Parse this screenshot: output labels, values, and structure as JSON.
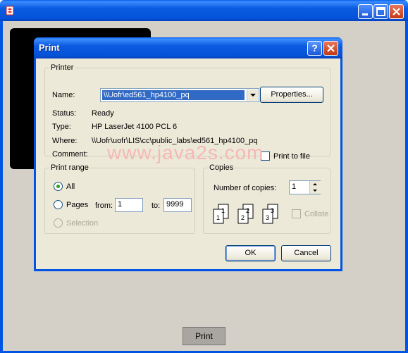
{
  "dialog": {
    "title": "Print",
    "help_label": "?"
  },
  "printer": {
    "group_label": "Printer",
    "name_label": "Name:",
    "name_value": "\\\\Uofr\\ed561_hp4100_pq",
    "properties_label": "Properties...",
    "status_label": "Status:",
    "status_value": "Ready",
    "type_label": "Type:",
    "type_value": "HP LaserJet 4100 PCL 6",
    "where_label": "Where:",
    "where_value": "\\\\Uofr\\uofr\\LIS\\cc\\public_labs\\ed561_hp4100_pq",
    "comment_label": "Comment:",
    "print_to_file_label": "Print to file"
  },
  "print_range": {
    "group_label": "Print range",
    "all_label": "All",
    "pages_label": "Pages",
    "from_label": "from:",
    "from_value": "1",
    "to_label": "to:",
    "to_value": "9999",
    "selection_label": "Selection"
  },
  "copies": {
    "group_label": "Copies",
    "number_label": "Number of copies:",
    "number_value": "1",
    "collate_label": "Collate",
    "page_icons": [
      "1",
      "1",
      "2",
      "2",
      "3",
      "3"
    ]
  },
  "actions": {
    "ok_label": "OK",
    "cancel_label": "Cancel"
  },
  "main": {
    "print_button_label": "Print"
  },
  "watermark": "www.java2s.com"
}
